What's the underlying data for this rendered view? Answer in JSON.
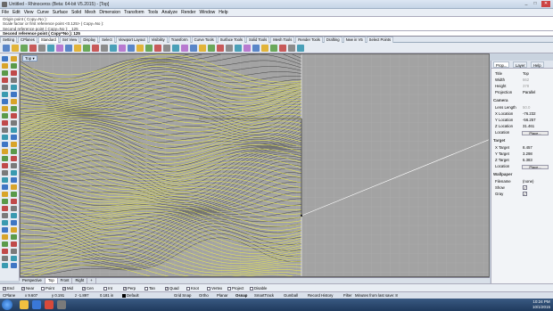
{
  "window": {
    "title": "Untitled - Rhinoceros (Beta: 64-bit V5.2015) - [Top]",
    "minimize": "_",
    "maximize": "□",
    "close": "✕"
  },
  "menu": [
    "File",
    "Edit",
    "View",
    "Curve",
    "Surface",
    "Solid",
    "Mesh",
    "Dimension",
    "Transform",
    "Tools",
    "Analyze",
    "Render",
    "Window",
    "Help"
  ],
  "history": [
    "Origin point ( Copy=No ):",
    "Scale factor or first reference point <0.125> ( Copy=No ):",
    "Second reference point ( Copy=No ): _125"
  ],
  "command_prompt": "Second reference point ( Copy=No ): 125",
  "toolbar_tabs": [
    "Setting",
    "CPlanes",
    "Standard",
    "Set View",
    "Display",
    "Select",
    "Viewport Layout",
    "Visibility",
    "Transform",
    "Curve Tools",
    "Surface Tools",
    "Solid Tools",
    "Mesh Tools",
    "Render Tools",
    "Drafting",
    "New in V5",
    "Select Points"
  ],
  "toolbar_active": "Standard",
  "viewport": {
    "label": "Top",
    "dropdown": "▾"
  },
  "viewport_tabs": [
    "Perspective",
    "Top",
    "Front",
    "Right"
  ],
  "viewport_active": "Top",
  "viewport_add": "+",
  "panel": {
    "tabs": [
      "Prop...",
      "Layer",
      "Help"
    ],
    "rows": [
      {
        "label": "Title",
        "value": "Top",
        "dim": false
      },
      {
        "label": "Width",
        "value": "662",
        "dim": true
      },
      {
        "label": "Height",
        "value": "378",
        "dim": true
      },
      {
        "label": "Projection",
        "value": "Parallel",
        "dim": false
      }
    ],
    "camera_title": "Camera",
    "camera": [
      {
        "label": "Lens Length",
        "value": "50.0",
        "dim": true
      },
      {
        "label": "X Location",
        "value": "-76.232",
        "dim": false
      },
      {
        "label": "Y Location",
        "value": "-56.257",
        "dim": false
      },
      {
        "label": "Z Location",
        "value": "31.461",
        "dim": false
      }
    ],
    "location_label": "Location",
    "place_button": "Place...",
    "target_title": "Target",
    "target": [
      {
        "label": "X Target",
        "value": "8.457",
        "dim": false
      },
      {
        "label": "Y Target",
        "value": "3.298",
        "dim": false
      },
      {
        "label": "Z Target",
        "value": "6.383",
        "dim": false
      }
    ],
    "target_location_label": "Location",
    "target_place_button": "Place...",
    "wallpaper_title": "Wallpaper",
    "filename_label": "Filename",
    "filename_value": "(none)",
    "show_label": "Show",
    "gray_label": "Gray"
  },
  "osnaps": [
    {
      "label": "End",
      "checked": true
    },
    {
      "label": "Near",
      "checked": true
    },
    {
      "label": "Point",
      "checked": false
    },
    {
      "label": "Mid",
      "checked": true
    },
    {
      "label": "Cen",
      "checked": true
    },
    {
      "label": "Int",
      "checked": false
    },
    {
      "label": "Perp",
      "checked": true
    },
    {
      "label": "Tan",
      "checked": false
    },
    {
      "label": "Quad",
      "checked": true
    },
    {
      "label": "Knot",
      "checked": false
    },
    {
      "label": "Vertex",
      "checked": false
    },
    {
      "label": "Project",
      "checked": false
    },
    {
      "label": "Disable",
      "checked": false
    }
  ],
  "status": {
    "cplane": "CPlane",
    "x": "x 9.607",
    "y": "y 0.191",
    "z": "z -1.897",
    "unit": "0.181 in",
    "layer": "Default",
    "toggles": [
      "Grid Snap",
      "Ortho",
      "Planar",
      "Osnap",
      "SmartTrack",
      "Gumball",
      "Record History",
      "Filter"
    ],
    "active_toggle": "Osnap",
    "message": "Minutes from last save: 8"
  },
  "clock": {
    "time": "10:24 PM",
    "date": "10/1/2015"
  },
  "colors": {
    "viewport_bg": "#a3a3a3",
    "selected_curves": "#ffff33",
    "wire_curves": "#1a1a1a",
    "axis": "#ffffff"
  }
}
